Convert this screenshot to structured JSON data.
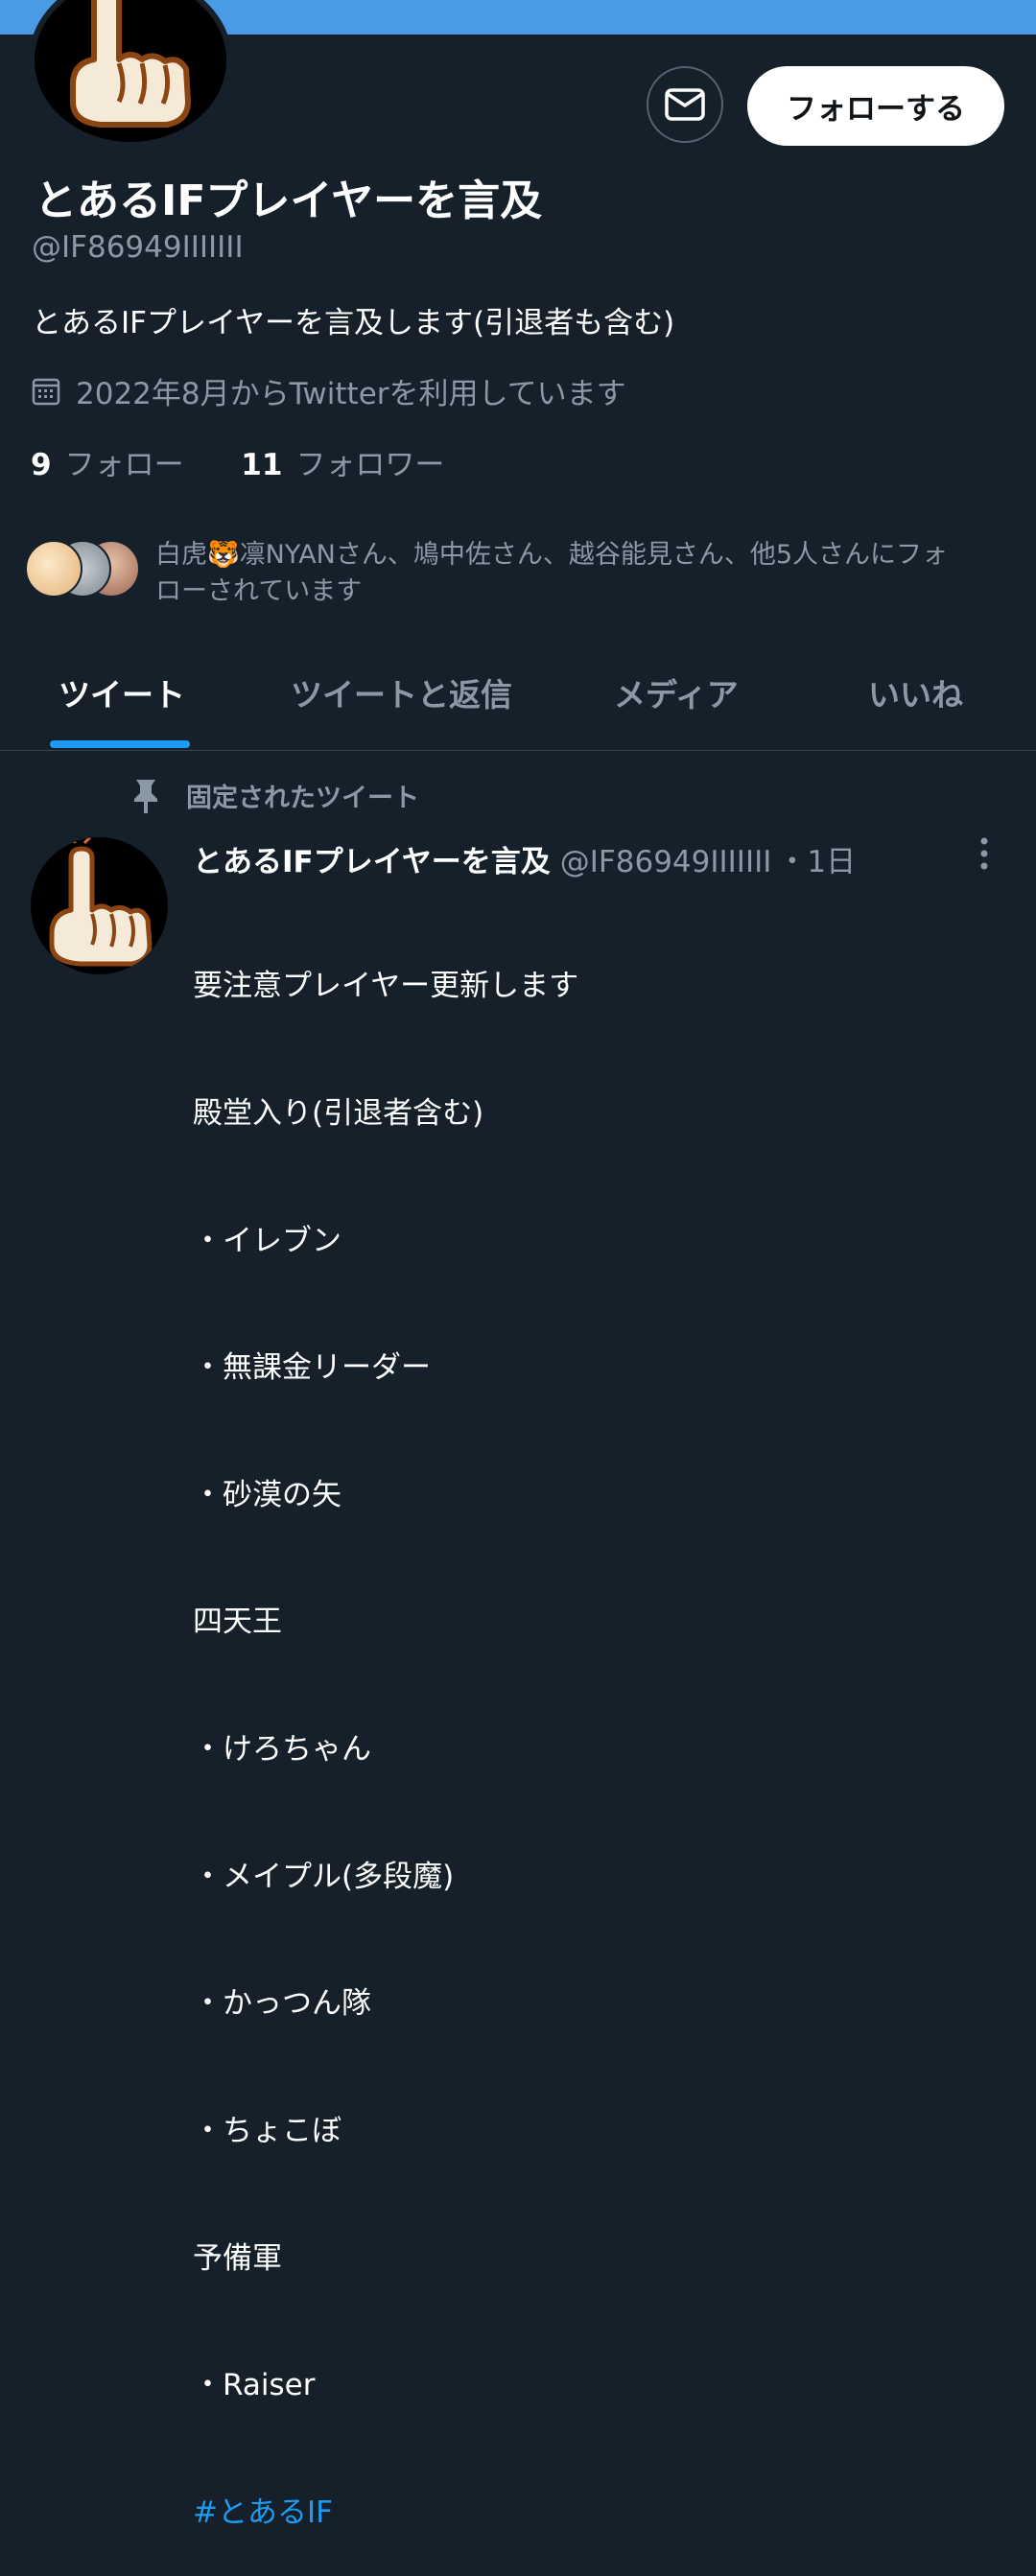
{
  "profile": {
    "name": "とあるIFプレイヤーを言及",
    "handle": "@IF86949IIIIIII",
    "bio": "とあるIFプレイヤーを言及します(引退者も含む)",
    "joined": "2022年8月からTwitterを利用しています",
    "following_count": "9",
    "following_label": "フォロー",
    "followers_count": "11",
    "followers_label": "フォロワー",
    "followed_by_line1": "白虎🐯凛NYANさん、鳩中佐さん、越谷能見さん、他5人さんにフォ",
    "followed_by_line2": "ローされています"
  },
  "actions": {
    "message_icon": "envelope-icon",
    "follow_label": "フォローする"
  },
  "tabs": [
    {
      "label": "ツイート",
      "active": true
    },
    {
      "label": "ツイートと返信",
      "active": false
    },
    {
      "label": "メディア",
      "active": false
    },
    {
      "label": "いいね",
      "active": false
    }
  ],
  "pinned_tweet": {
    "pinned_label": "固定されたツイート",
    "author_name": "とあるIFプレイヤーを言及",
    "author_handle": "@IF86949IIIIIII",
    "time": "・1日",
    "lines": [
      "要注意プレイヤー更新します",
      "殿堂入り(引退者含む)",
      "・イレブン",
      "・無課金リーダー",
      "・砂漠の矢",
      "四天王",
      "・けろちゃん",
      "・メイプル(多段魔)",
      "・かっつん隊",
      "・ちょこぼ",
      "予備軍",
      "・Raiser"
    ],
    "hashtag": "#とあるIF"
  },
  "colors": {
    "background": "#15202b",
    "banner": "#4a9be6",
    "accent": "#1d9bf0",
    "muted_text": "#8b98a5"
  }
}
